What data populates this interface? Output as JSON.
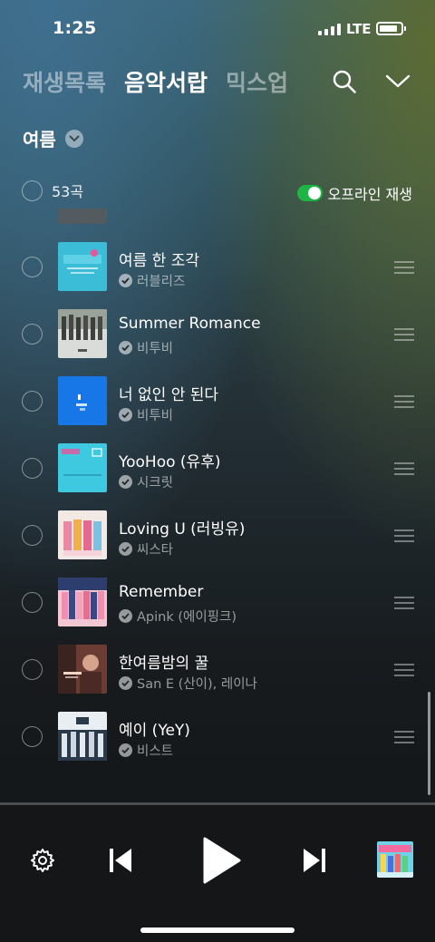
{
  "status": {
    "time": "1:25",
    "network": "LTE"
  },
  "tabs": [
    {
      "label": "재생목록",
      "active": false
    },
    {
      "label": "음악서랍",
      "active": true
    },
    {
      "label": "믹스업",
      "active": false
    }
  ],
  "playlist": {
    "name": "여름"
  },
  "list_header": {
    "count_label": "53곡",
    "offline_label": "오프라인 재생",
    "offline_enabled": true
  },
  "songs": [
    {
      "title": "여름 한 조각",
      "artist": "러블리즈"
    },
    {
      "title": "Summer Romance",
      "artist": "비투비"
    },
    {
      "title": "너 없인 안 된다",
      "artist": "비투비"
    },
    {
      "title": "YooHoo (유후)",
      "artist": "시크릿"
    },
    {
      "title": "Loving U (러빙유)",
      "artist": "씨스타"
    },
    {
      "title": "Remember",
      "artist": "Apink (에이핑크)"
    },
    {
      "title": "한여름밤의 꿀",
      "artist": "San E (산이), 레이나"
    },
    {
      "title": "예이 (YeY)",
      "artist": "비스트"
    }
  ],
  "icons": {
    "search": "search-icon",
    "collapse": "chevron-down-icon",
    "settings": "gear-icon",
    "previous": "skip-back-icon",
    "play": "play-icon",
    "next": "skip-forward-icon"
  },
  "colors": {
    "toggle_on": "#1fb545"
  }
}
